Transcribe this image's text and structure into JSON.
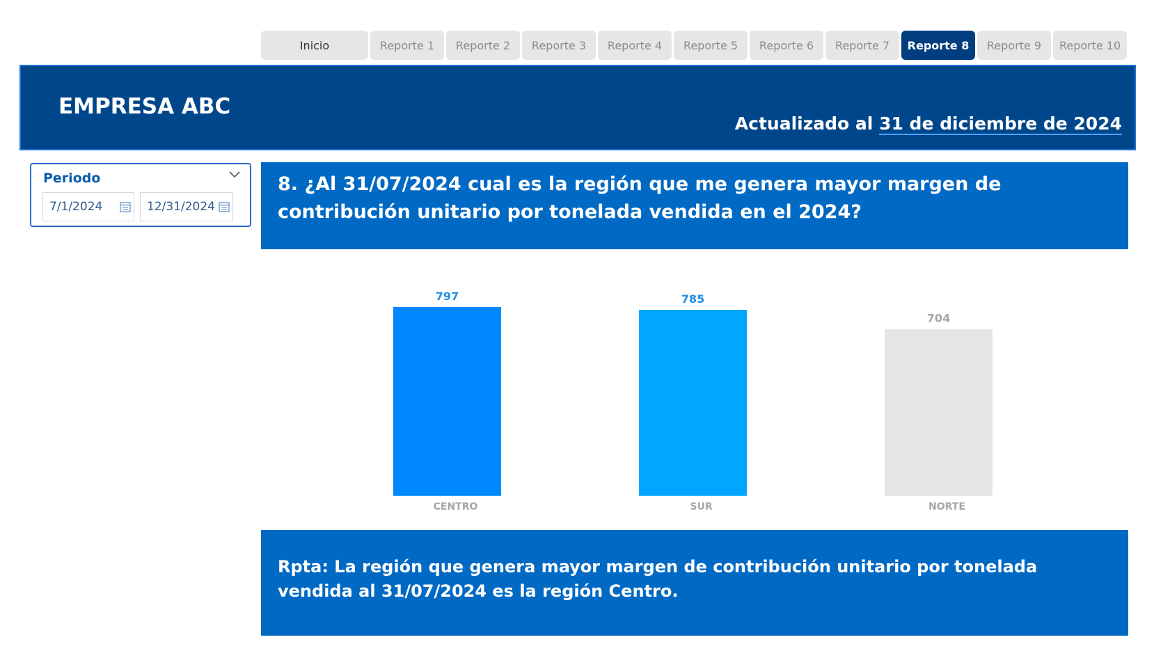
{
  "nav": {
    "tabs": [
      {
        "label": "Inicio",
        "active": false
      },
      {
        "label": "Reporte 1",
        "active": false
      },
      {
        "label": "Reporte 2",
        "active": false
      },
      {
        "label": "Reporte 3",
        "active": false
      },
      {
        "label": "Reporte 4",
        "active": false
      },
      {
        "label": "Reporte 5",
        "active": false
      },
      {
        "label": "Reporte 6",
        "active": false
      },
      {
        "label": "Reporte 7",
        "active": false
      },
      {
        "label": "Reporte 8",
        "active": true
      },
      {
        "label": "Reporte 9",
        "active": false
      },
      {
        "label": "Reporte 10",
        "active": false
      }
    ]
  },
  "header": {
    "company": "EMPRESA ABC",
    "updated_prefix": "Actualizado al ",
    "updated_date": "31 de diciembre de 2024"
  },
  "slicer": {
    "title": "Periodo",
    "start_date": "7/1/2024",
    "end_date": "12/31/2024",
    "icons": {
      "expand": "chevron-down-icon",
      "calendar": "calendar-icon"
    }
  },
  "question": "8. ¿Al 31/07/2024 cual es la región que me genera mayor margen de contribución unitario por tonelada vendida en el 2024?",
  "answer": "Rpta: La región que genera mayor margen de contribución unitario por tonelada vendida al 31/07/2024 es la región Centro.",
  "colors": {
    "nav_tab": "#e6e6e6",
    "nav_active": "#003e80",
    "banner": "#00468a",
    "panel": "#0069c4"
  },
  "chart_data": {
    "type": "bar",
    "categories": [
      "CENTRO",
      "SUR",
      "NORTE"
    ],
    "values": [
      797,
      785,
      704
    ],
    "bar_colors": [
      "#0088ff",
      "#00a6ff",
      "#e6e6e6"
    ],
    "label_colors": [
      "#1f8fe6",
      "#1f8fe6",
      "#a6a6a6"
    ],
    "ylim": [
      0,
      797
    ],
    "grid": false,
    "legend": "none"
  }
}
